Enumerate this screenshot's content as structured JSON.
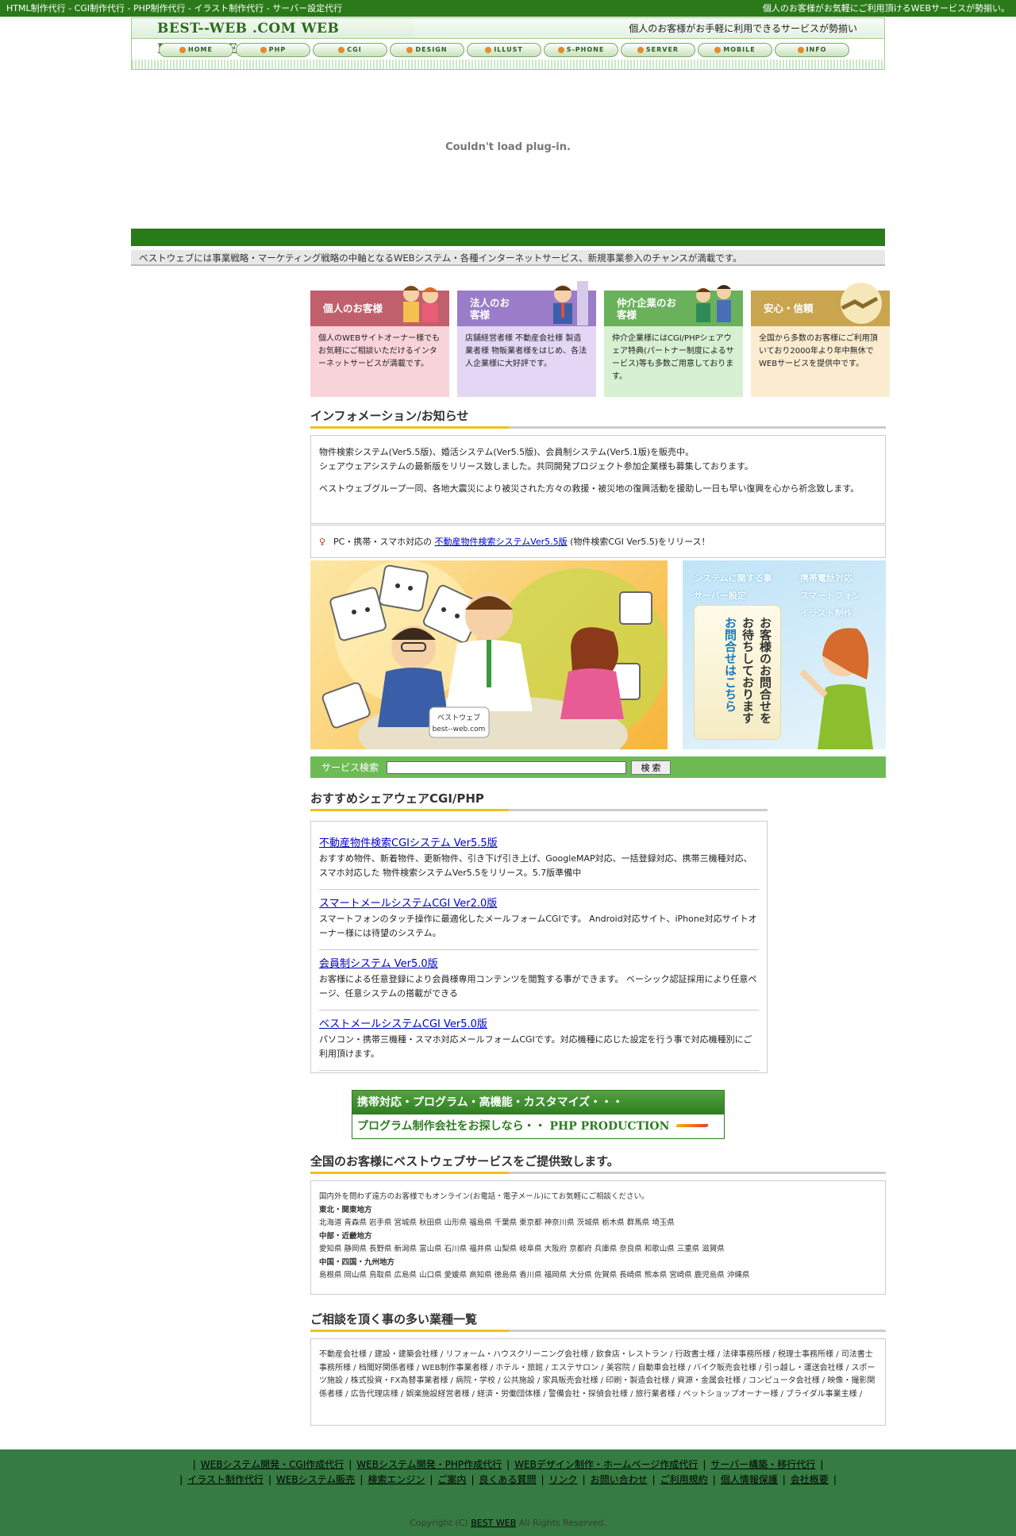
{
  "topbar": {
    "left": "HTML制作代行 - CGI制作代行 - PHP制作代行 - イラスト制作代行 - サーバー設定代行",
    "right": "個人のお客様がお気軽にご利用頂けるWEBサービスが勢揃い。"
  },
  "header": {
    "logo": "BEST--WEB .COM WEB PRODUCE",
    "tagline": "個人のお客様がお手軽に利用できるサービスが勢揃い"
  },
  "nav": [
    "HOME",
    "PHP",
    "CGI",
    "DESIGN",
    "ILLUST",
    "S-PHONE",
    "SERVER",
    "MOBILE",
    "INFO"
  ],
  "plugin_message": "Couldn't load plug-in.",
  "notice": "ベストウェブには事業戦略・マーケティング戦略の中軸となるWEBシステム・各種インターネットサービス、新規事業参入のチャンスが満載です。",
  "cards": [
    {
      "title": "個人のお客様",
      "body": "個人のWEBサイトオーナー様でもお気軽にご相談いただけるインターネットサービスが満載です。",
      "color": "#c0606c",
      "bg": "#f9d3da"
    },
    {
      "title": "法人のお客様",
      "body": "店舗経営者様 不動産会社様 製造業者様 物販業者様をはじめ、各法人企業様に大好評です。",
      "color": "#9a7cc9",
      "bg": "#e3d7f5"
    },
    {
      "title": "仲介企業のお客様",
      "body": "仲介企業様にはCGI/PHPシェアウェア特典(パートナー制度によるサービス)等も多数ご用意しております。",
      "color": "#6ab15c",
      "bg": "#d7f0d1"
    },
    {
      "title": "安心・信頼",
      "body": "全国から多数のお客様にご利用頂いており2000年より年中無休でWEBサービスを提供中です。",
      "color": "#c8a54e",
      "bg": "#fbecd0"
    }
  ],
  "info": {
    "title": "インフォメーション/お知らせ",
    "lines": [
      "物件検索システム(Ver5.5版)、婚活システム(Ver5.5版)、会員制システム(Ver5.1版)を販売中。",
      "シェアウェアシステムの最新版をリリース致しました。共同開発プロジェクト参加企業様も募集しております。",
      "ベストウェブグループ一同、各地大震災により被災された方々の救援・被災地の復興活動を援助し一日も早い復興を心から祈念致します。"
    ]
  },
  "news": {
    "prefix": "PC・携帯・スマホ対応の",
    "link": "不動産物件検索システムVer5.5版",
    "suffix": "(物件検索CGI Ver5.5)をリリース！"
  },
  "illustration": {
    "caption1": "ベストウェブ",
    "caption2": "best--web.com"
  },
  "contact": {
    "tags_left": [
      "システムに関する事",
      "サーバー設定"
    ],
    "tags_right": [
      "携帯電話対応",
      "スマートフォン",
      "イラスト制作"
    ],
    "text1": "お客様のお問合せを",
    "text2": "お待ちしております",
    "link": "お問合せはこちら"
  },
  "search": {
    "label": "サービス検索",
    "button": "検 索",
    "value": ""
  },
  "recommend": {
    "title": "おすすめシェアウェアCGI/PHP",
    "items": [
      {
        "link": "不動産物件検索CGIシステム Ver5.5版",
        "desc": "おすすめ物件、新着物件、更新物件、引き下げ引き上げ、GoogleMAP対応、一括登録対応、携帯三機種対応、スマホ対応した 物件検索システムVer5.5をリリース。5.7版準備中"
      },
      {
        "link": "スマートメールシステムCGI Ver2.0版",
        "desc": "スマートフォンのタッチ操作に最適化したメールフォームCGIです。 Android対応サイト、iPhone対応サイトオーナー様には待望のシステム。"
      },
      {
        "link": "会員制システム Ver5.0版",
        "desc": "お客様による任意登録により会員様専用コンテンツを閲覧する事ができます。 ベーシック認証採用により任意ページ、任意システムの搭載ができる"
      },
      {
        "link": "ベストメールシステムCGI Ver5.0版",
        "desc": "パソコン・携帯三機種・スマホ対応メールフォームCGIです。対応機種に応じた設定を行う事で対応機種別にご利用頂けます。"
      }
    ]
  },
  "banner": {
    "line1": "携帯対応・プログラム・高機能・カスタマイズ・・・",
    "line2": "プログラム制作会社をお探しなら・・ PHP PRODUCTION"
  },
  "areas": {
    "title": "全国のお客様にベストウェブサービスをご提供致します。",
    "intro": "国内外を問わず遠方のお客様でもオンライン(お電話・電子メール)にてお気軽にご相談ください。",
    "groups": [
      {
        "name": "東北・関東地方",
        "list": "北海道 青森県 岩手県 宮城県 秋田県 山形県 福島県 千葉県 東京都 神奈川県 茨城県 栃木県 群馬県 埼玉県"
      },
      {
        "name": "中部・近畿地方",
        "list": "愛知県 静岡県 長野県 新潟県 富山県 石川県 福井県 山梨県 岐阜県 大阪府 京都府 兵庫県 奈良県 和歌山県 三重県 滋賀県"
      },
      {
        "name": "中国・四国・九州地方",
        "list": "島根県 岡山県 鳥取県 広島県 山口県 愛媛県 高知県 徳島県 香川県 福岡県 大分県 佐賀県 長崎県 熊本県 宮崎県 鹿児島県 沖縄県"
      }
    ]
  },
  "industries": {
    "title": "ご相談を頂く事の多い業種一覧",
    "text": "不動産会社様 / 建設・建築会社様 / リフォーム・ハウスクリーニング会社様 / 飲食店・レストラン / 行政書士様 / 法律事務所様 / 税理士事務所様 / 司法書士事務所様 / 档聞好関係者様 / WEB制作事業者様 / ホテル・旅館 / エステサロン / 美容院 / 自動車会社様 / バイク販売会社様 / 引っ越し・運送会社様 / スポーツ施設 / 株式投資・FX為替事業者様 / 病院・学校 / 公共施設 / 家具販売会社様 / 印刷・製造会社様 / 資源・金属会社様 / コンピュータ会社様 / 映像・撮影関係者様 / 広告代理店様 / 娯楽施設経営者様 / 経済・労働団体様 / 警備会社・探偵会社様 / 旅行業者様 / ペットショップオーナー様 / ブライダル事業主様 /"
  },
  "footer": {
    "row1": [
      "WEBシステム開発・CGI作成代行",
      "WEBシステム開発・PHP作成代行",
      "WEBデザイン制作・ホームページ作成代行",
      "サーバー構築・移行代行"
    ],
    "row2": [
      "イラスト制作代行",
      "WEBシステム販売",
      "検索エンジン",
      "ご案内",
      "良くある質問",
      "リンク",
      "お問い合わせ",
      "ご利用規約",
      "個人情報保護",
      "会社概要"
    ],
    "copy_prefix": "Copyright (C)",
    "copy_link": "BEST WEB",
    "copy_suffix": "All Rights Reserved."
  }
}
